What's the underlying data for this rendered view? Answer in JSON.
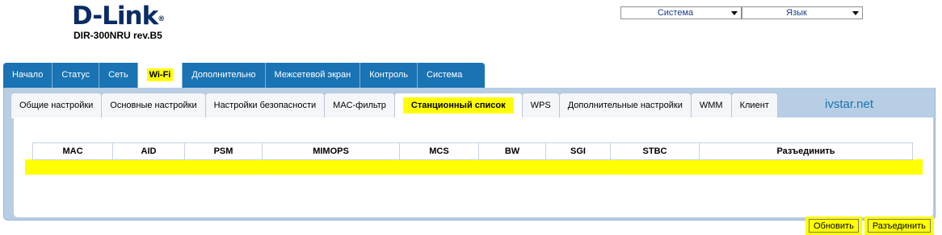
{
  "logo": {
    "brand": "D-Link",
    "reg": "®",
    "model": "DIR-300NRU rev.B5"
  },
  "top_selects": {
    "system": "Система",
    "language": "Язык"
  },
  "main_tabs": [
    "Начало",
    "Статус",
    "Сеть",
    "Wi-Fi",
    "Дополнительно",
    "Межсетевой экран",
    "Контроль",
    "Система"
  ],
  "sub_tabs": [
    "Общие настройки",
    "Основные настройки",
    "Настройки безопасности",
    "MAC-фильтр",
    "Станционный список",
    "WPS",
    "Дополнительные настройки",
    "WMM",
    "Клиент"
  ],
  "watermark": "ivstar.net",
  "table": {
    "headers": [
      "MAC",
      "AID",
      "PSM",
      "MIMOPS",
      "MCS",
      "BW",
      "SGI",
      "STBC",
      "Разъединить"
    ]
  },
  "buttons": {
    "refresh": "Обновить",
    "disconnect": "Разъединить"
  },
  "colors": {
    "tab_bar": "#1a73b3",
    "sub_panel": "#b7cee4",
    "highlight": "#ffff00",
    "brand": "#0a2c64"
  }
}
